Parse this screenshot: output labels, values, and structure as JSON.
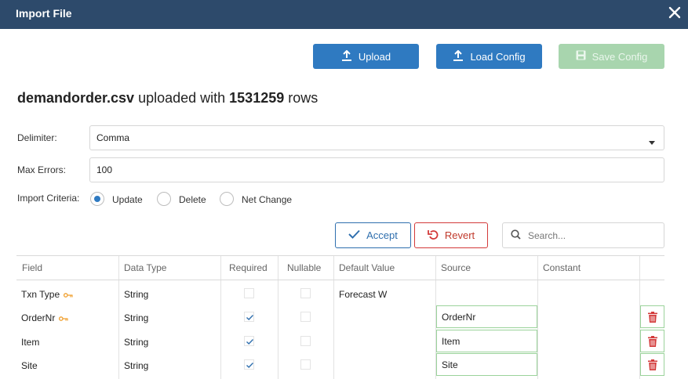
{
  "dialog": {
    "title": "Import File",
    "close_icon": "close-icon"
  },
  "toolbar": {
    "upload_label": "Upload",
    "load_config_label": "Load Config",
    "save_config_label": "Save Config"
  },
  "file": {
    "name": "demandorder.csv",
    "mid": " uploaded with ",
    "count": "1531259",
    "suffix": " rows"
  },
  "form": {
    "delimiter_label": "Delimiter:",
    "delimiter_value": "Comma",
    "max_errors_label": "Max Errors:",
    "max_errors_value": "100",
    "criteria_label": "Import Criteria:",
    "criteria_options": [
      "Update",
      "Delete",
      "Net Change"
    ],
    "criteria_selected": "Update"
  },
  "actions": {
    "accept_label": "Accept",
    "revert_label": "Revert",
    "search_placeholder": "Search..."
  },
  "table": {
    "columns": [
      "Field",
      "Data Type",
      "Required",
      "Nullable",
      "Default Value",
      "Source",
      "Constant",
      ""
    ],
    "rows": [
      {
        "field": "Txn Type",
        "key": true,
        "type": "String",
        "required": false,
        "nullable": false,
        "default": "Forecast W",
        "source": "",
        "constant": "",
        "deletable": false
      },
      {
        "field": "OrderNr",
        "key": true,
        "type": "String",
        "required": true,
        "nullable": false,
        "default": "",
        "source": "OrderNr",
        "constant": "",
        "deletable": true
      },
      {
        "field": "Item",
        "key": false,
        "type": "String",
        "required": true,
        "nullable": false,
        "default": "",
        "source": "Item",
        "constant": "",
        "deletable": true
      },
      {
        "field": "Site",
        "key": false,
        "type": "String",
        "required": true,
        "nullable": false,
        "default": "",
        "source": "Site",
        "constant": "",
        "deletable": true
      }
    ]
  },
  "colors": {
    "header": "#2d4a6b",
    "primary": "#2f7ac1",
    "disabled": "#a8d5ae",
    "danger": "#d33a3a",
    "key_icon": "#f0a030"
  }
}
